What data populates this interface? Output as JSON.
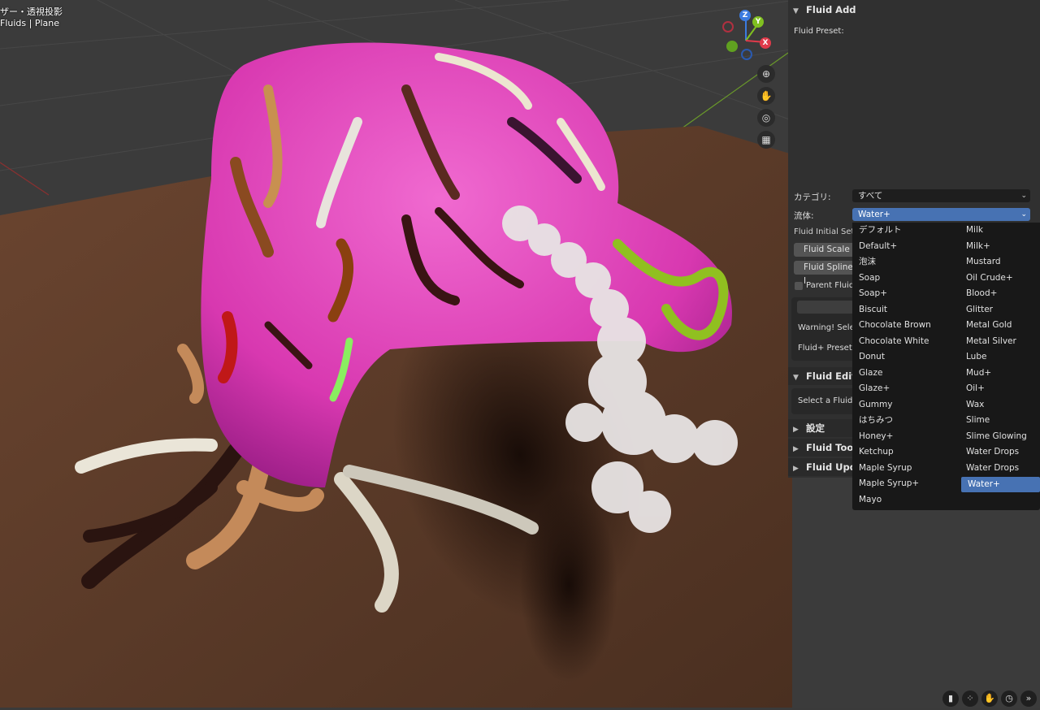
{
  "viewport": {
    "title": "ザー・透視投影",
    "subtitle": "Fluids | Plane",
    "gizmo": {
      "z": "Z",
      "y": "Y",
      "x": "X"
    },
    "nav_icons": [
      "zoom-icon",
      "hand-icon",
      "camera-icon",
      "grid-icon"
    ]
  },
  "panel": {
    "header": "Fluid Add",
    "preset_label": "Fluid Preset:",
    "category_label": "カテゴリ:",
    "category_value": "すべて",
    "fluid_label": "流体:",
    "fluid_value": "Water+",
    "initial_settings": "Fluid Initial Sett",
    "scale_button": "Fluid Scale",
    "spline_button": "Fluid Spline I",
    "parent_fluid": "Parent Fluid",
    "warning": "Warning! Selec",
    "preset_note": "Fluid+ Preset.",
    "editing_header": "Fluid Editin",
    "select_fluid": "Select a Fluid",
    "settings_header": "設定",
    "tools_header": "Fluid Tools",
    "update_header": "Fluid Upda"
  },
  "fluid_menu": {
    "left": [
      "デフォルト",
      "Default+",
      "泡沫",
      "Soap",
      "Soap+",
      "Biscuit",
      "Chocolate Brown",
      "Chocolate White",
      "Donut",
      "Glaze",
      "Glaze+",
      "Gummy",
      "はちみつ",
      "Honey+",
      "Ketchup",
      "Maple Syrup",
      "Maple Syrup+",
      "Mayo"
    ],
    "right": [
      "Milk",
      "Milk+",
      "Mustard",
      "Oil Crude+",
      "Blood+",
      "Glitter",
      "Metal Gold",
      "Metal Silver",
      "Lube",
      "Mud+",
      "Oil+",
      "Wax",
      "Slime",
      "Slime Glowing",
      "Water Drops",
      "Water Drops Anim",
      "Water+"
    ],
    "selected": "Water+"
  },
  "colors": {
    "accent": "#4772b3",
    "panel_bg": "#303030",
    "menu_bg": "#181818",
    "body_pink": "#e040b8"
  }
}
